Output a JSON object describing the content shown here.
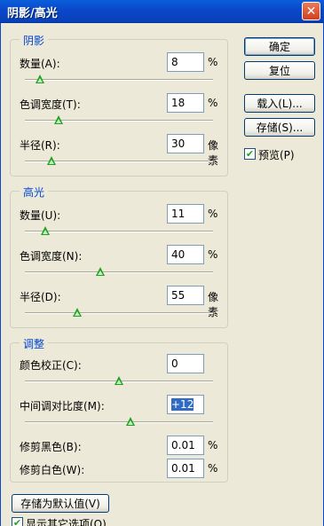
{
  "window": {
    "title": "阴影/高光",
    "close_symbol": "✕"
  },
  "shadows": {
    "legend": "阴影",
    "amount": {
      "label": "数量(A):",
      "value": "8",
      "unit": "%",
      "level_pct": 8
    },
    "tonal_width": {
      "label": "色调宽度(T):",
      "value": "18",
      "unit": "%",
      "level_pct": 18
    },
    "radius": {
      "label": "半径(R):",
      "value": "30",
      "unit": "像素",
      "level_pct": 14
    }
  },
  "highlights": {
    "legend": "高光",
    "amount": {
      "label": "数量(U):",
      "value": "11",
      "unit": "%",
      "level_pct": 11
    },
    "tonal_width": {
      "label": "色调宽度(N):",
      "value": "40",
      "unit": "%",
      "level_pct": 40
    },
    "radius": {
      "label": "半径(D):",
      "value": "55",
      "unit": "像素",
      "level_pct": 28
    }
  },
  "adjustments": {
    "legend": "调整",
    "color_correction": {
      "label": "颜色校正(C):",
      "value": "0",
      "level_pct": 50
    },
    "midtone_contrast": {
      "label": "中间调对比度(M):",
      "value": "+12",
      "level_pct": 56
    },
    "black_clip": {
      "label": "修剪黑色(B):",
      "value": "0.01",
      "unit": "%"
    },
    "white_clip": {
      "label": "修剪白色(W):",
      "value": "0.01",
      "unit": "%"
    }
  },
  "buttons": {
    "ok": "确定",
    "reset": "复位",
    "load": "载入(L)...",
    "save": "存储(S)...",
    "save_defaults": "存储为默认值(V)"
  },
  "preview": {
    "label": "预览(P)",
    "checked": true,
    "check_symbol": "✔"
  },
  "more_options": {
    "label": "显示其它选项(O)",
    "checked": true,
    "check_symbol": "✔"
  }
}
